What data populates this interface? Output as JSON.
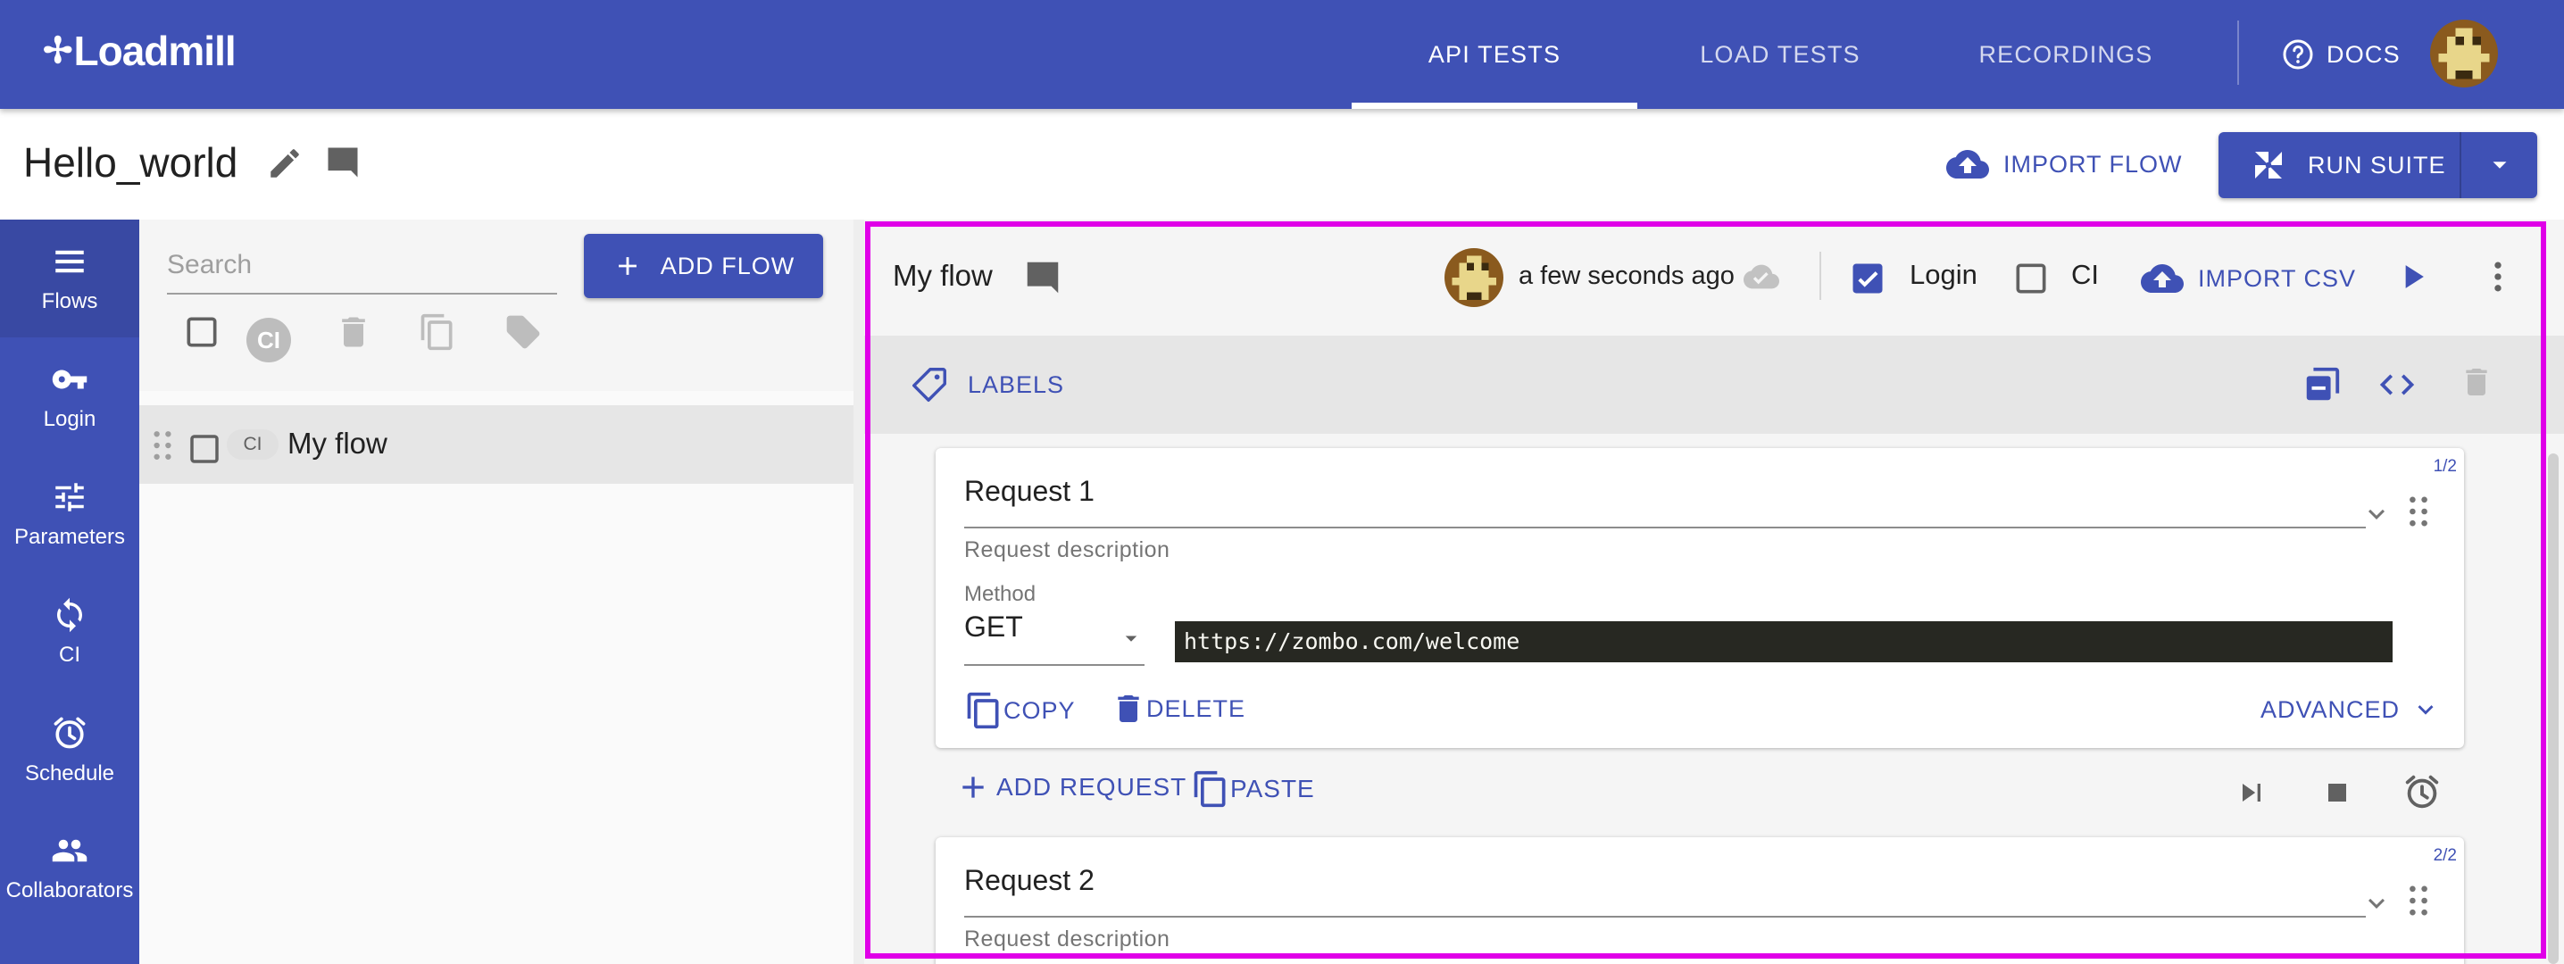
{
  "app": {
    "logo_text": "Loadmill"
  },
  "nav": {
    "tabs": [
      {
        "label": "API TESTS",
        "active": true
      },
      {
        "label": "LOAD TESTS",
        "active": false
      },
      {
        "label": "RECORDINGS",
        "active": false
      }
    ],
    "docs_label": "DOCS"
  },
  "suite": {
    "title": "Hello_world",
    "import_flow_label": "IMPORT FLOW",
    "run_suite_label": "RUN SUITE"
  },
  "rail": {
    "items": [
      {
        "label": "Flows",
        "icon": "menu-icon",
        "active": true
      },
      {
        "label": "Login",
        "icon": "key-icon"
      },
      {
        "label": "Parameters",
        "icon": "tune-icon"
      },
      {
        "label": "CI",
        "icon": "sync-icon"
      },
      {
        "label": "Schedule",
        "icon": "alarm-icon"
      },
      {
        "label": "Collaborators",
        "icon": "people-icon"
      }
    ]
  },
  "flows_panel": {
    "search_placeholder": "Search",
    "add_flow_label": "ADD FLOW",
    "ci_chip": "CI",
    "flows": [
      {
        "name": "My flow",
        "ci_badge": "CI",
        "checked": false
      }
    ]
  },
  "editor": {
    "flow_name": "My flow",
    "saved_time": "a few seconds ago",
    "login_label": "Login",
    "login_checked": true,
    "ci_label": "CI",
    "ci_checked": false,
    "import_csv_label": "IMPORT CSV",
    "labels_label": "LABELS",
    "requests": [
      {
        "counter": "1/2",
        "name": "Request 1",
        "description": "Request description",
        "method_label": "Method",
        "method": "GET",
        "url": "https://zombo.com/welcome",
        "copy_label": "COPY",
        "delete_label": "DELETE",
        "advanced_label": "ADVANCED"
      },
      {
        "counter": "2/2",
        "name": "Request 2",
        "description": "Request description"
      }
    ],
    "add_request_label": "ADD REQUEST",
    "paste_label": "PASTE"
  },
  "colors": {
    "primary": "#3f51b5",
    "highlight_border": "#e000e8",
    "url_background": "#272822"
  }
}
